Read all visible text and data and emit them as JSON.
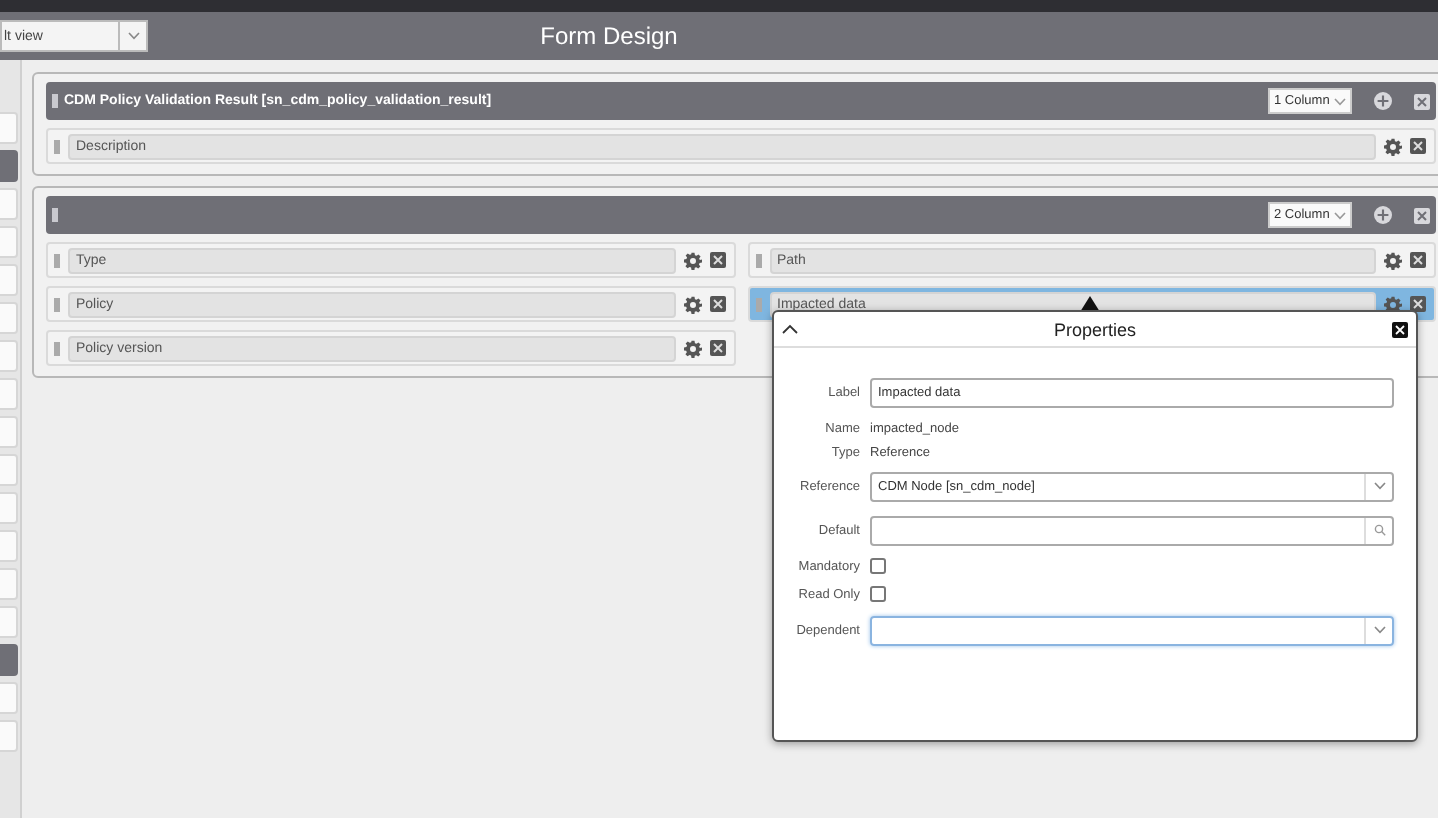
{
  "header": {
    "view_select": {
      "value": "lt view"
    },
    "title": "Form Design"
  },
  "sidebar": {
    "items": [
      {
        "selected": false
      },
      {
        "selected": true
      },
      {
        "selected": false
      },
      {
        "selected": false
      },
      {
        "selected": false
      },
      {
        "selected": false
      },
      {
        "selected": false
      },
      {
        "selected": false
      },
      {
        "selected": false
      },
      {
        "selected": false
      },
      {
        "selected": false
      },
      {
        "selected": false
      },
      {
        "selected": false
      },
      {
        "selected": false
      },
      {
        "selected": true
      },
      {
        "selected": false
      },
      {
        "selected": false
      }
    ]
  },
  "sections": [
    {
      "title": "CDM Policy Validation Result [sn_cdm_policy_validation_result]",
      "columns_select": "1 Column",
      "columns": [
        [
          {
            "label": "Description",
            "selected": false
          }
        ]
      ]
    },
    {
      "columns_select": "2 Column",
      "columns": [
        [
          {
            "label": "Type",
            "selected": false
          },
          {
            "label": "Policy",
            "selected": false
          },
          {
            "label": "Policy version",
            "selected": false
          }
        ],
        [
          {
            "label": "Path",
            "selected": false
          },
          {
            "label": "Impacted data",
            "selected": true
          }
        ]
      ]
    }
  ],
  "properties": {
    "title": "Properties",
    "fields": [
      {
        "kind": "text",
        "label": "Label",
        "value": "Impacted data"
      },
      {
        "kind": "static",
        "label": "Name",
        "value": "impacted_node"
      },
      {
        "kind": "static",
        "label": "Type",
        "value": "Reference"
      },
      {
        "kind": "select",
        "label": "Reference",
        "value": "CDM Node [sn_cdm_node]",
        "focused": false
      },
      {
        "kind": "lookup",
        "label": "Default"
      },
      {
        "kind": "checkbox",
        "label": "Mandatory",
        "checked": false
      },
      {
        "kind": "checkbox",
        "label": "Read Only",
        "checked": false
      },
      {
        "kind": "select",
        "label": "Dependent",
        "focused": true
      }
    ]
  }
}
